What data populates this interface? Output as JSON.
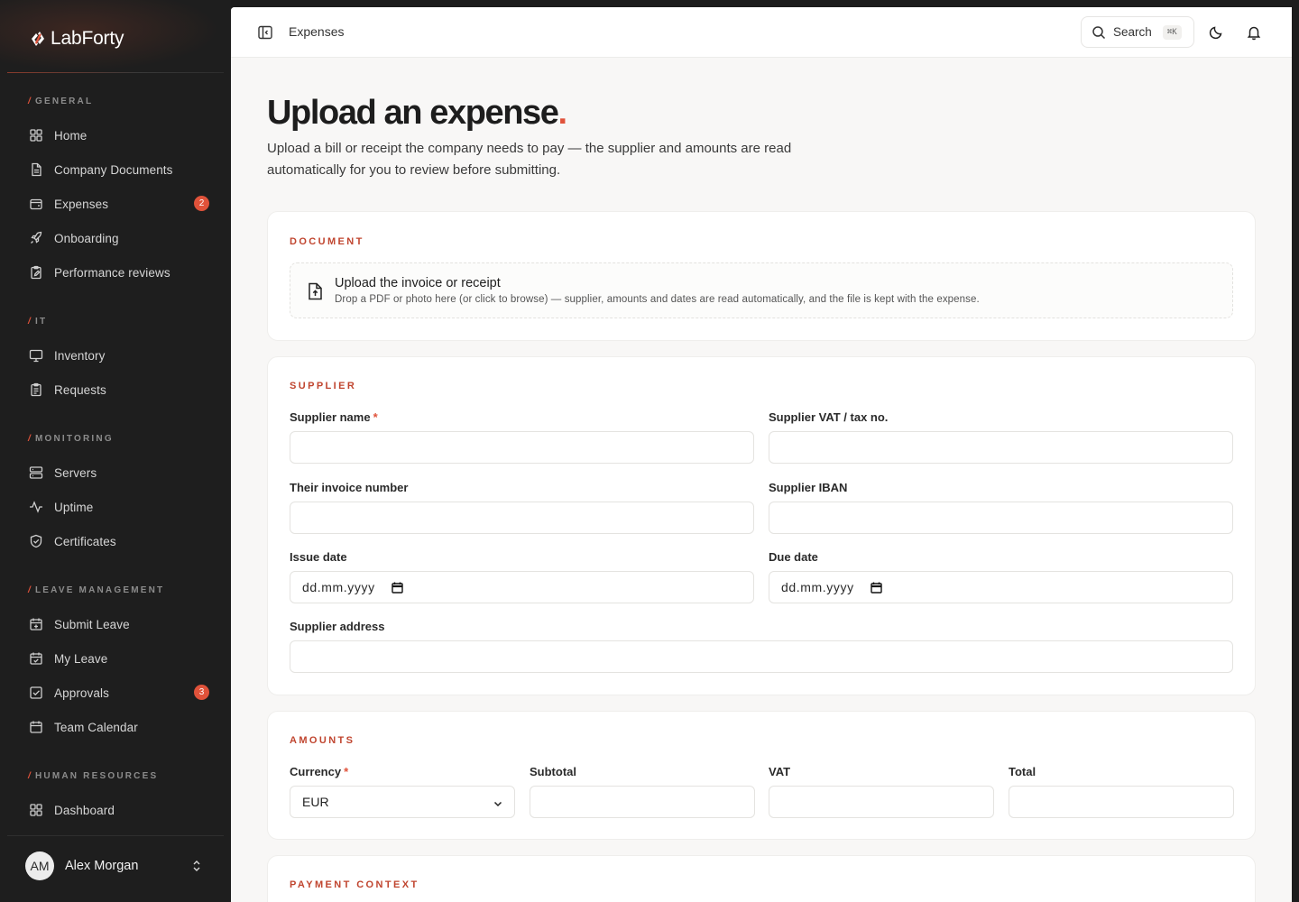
{
  "brand": {
    "name": "LabForty"
  },
  "sidebar": {
    "sections": [
      {
        "label": "GENERAL",
        "items": [
          {
            "label": "Home",
            "icon": "grid-icon"
          },
          {
            "label": "Company Documents",
            "icon": "document-icon"
          },
          {
            "label": "Expenses",
            "icon": "wallet-icon",
            "badge": "2"
          },
          {
            "label": "Onboarding",
            "icon": "rocket-icon"
          },
          {
            "label": "Performance reviews",
            "icon": "clipboard-edit-icon"
          }
        ]
      },
      {
        "label": "IT",
        "items": [
          {
            "label": "Inventory",
            "icon": "monitor-icon"
          },
          {
            "label": "Requests",
            "icon": "clipboard-list-icon"
          }
        ]
      },
      {
        "label": "MONITORING",
        "items": [
          {
            "label": "Servers",
            "icon": "server-icon"
          },
          {
            "label": "Uptime",
            "icon": "activity-icon"
          },
          {
            "label": "Certificates",
            "icon": "shield-check-icon"
          }
        ]
      },
      {
        "label": "LEAVE MANAGEMENT",
        "items": [
          {
            "label": "Submit Leave",
            "icon": "calendar-plus-icon"
          },
          {
            "label": "My Leave",
            "icon": "calendar-check-icon"
          },
          {
            "label": "Approvals",
            "icon": "check-square-icon",
            "badge": "3"
          },
          {
            "label": "Team Calendar",
            "icon": "calendar-icon"
          }
        ]
      },
      {
        "label": "HUMAN RESOURCES",
        "items": [
          {
            "label": "Dashboard",
            "icon": "grid-icon"
          }
        ]
      }
    ],
    "user": {
      "initials": "AM",
      "name": "Alex Morgan"
    }
  },
  "topbar": {
    "breadcrumb": "Expenses",
    "search_label": "Search",
    "search_shortcut": "⌘K"
  },
  "page": {
    "title": "Upload an expense",
    "title_dot": ".",
    "subtitle": "Upload a bill or receipt the company needs to pay — the supplier and amounts are read automatically for you to review before submitting."
  },
  "document": {
    "title": "DOCUMENT",
    "upload_title": "Upload the invoice or receipt",
    "upload_desc": "Drop a PDF or photo here (or click to browse) — supplier, amounts and dates are read automatically, and the file is kept with the expense."
  },
  "supplier": {
    "title": "SUPPLIER",
    "name_label": "Supplier name",
    "vat_label": "Supplier VAT / tax no.",
    "invoice_label": "Their invoice number",
    "iban_label": "Supplier IBAN",
    "issue_label": "Issue date",
    "due_label": "Due date",
    "date_placeholder": "dd.mm.yyyy",
    "address_label": "Supplier address",
    "required_mark": "*"
  },
  "amounts": {
    "title": "AMOUNTS",
    "currency_label": "Currency",
    "currency_value": "EUR",
    "subtotal_label": "Subtotal",
    "vat_label": "VAT",
    "total_label": "Total"
  },
  "payment": {
    "title": "PAYMENT CONTEXT"
  },
  "colors": {
    "accent": "#e0523a",
    "section_title": "#c0452f",
    "sidebar_bg": "#1e1e1e"
  }
}
